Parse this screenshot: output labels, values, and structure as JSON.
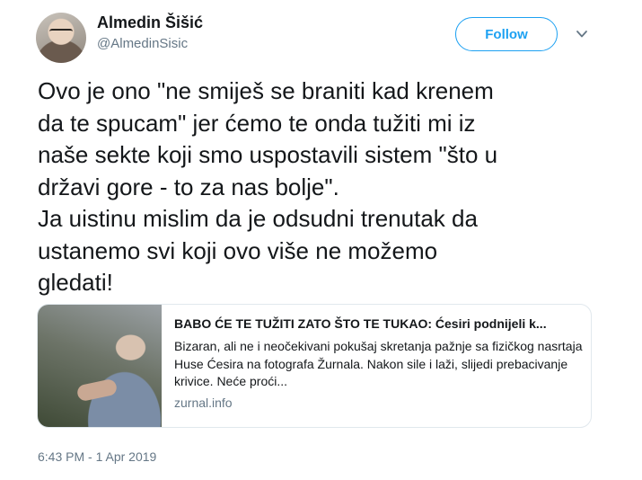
{
  "author": {
    "name": "Almedin Šišić",
    "handle": "@AlmedinSisic"
  },
  "follow_label": "Follow",
  "tweet": {
    "lines": [
      "Ovo je ono \"ne smiješ se braniti kad krenem",
      "da te spucam\" jer ćemo te onda tužiti mi iz",
      "naše sekte koji smo uspostavili sistem \"što u",
      "državi gore - to za nas bolje\".",
      "Ja uistinu mislim da je odsudni trenutak da",
      "ustanemo svi koji ovo više ne možemo",
      "gledati!"
    ]
  },
  "card": {
    "title": "BABO ĆE TE TUŽITI ZATO ŠTO TE TUKAO: Ćesiri podnijeli k...",
    "description": "Bizaran, ali ne i neočekivani pokušaj skretanja pažnje sa fizičkog nasrtaja Huse Ćesira na fotografa Žurnala. Nakon sile i laži, slijedi prebacivanje krivice. Neće proći...",
    "domain": "zurnal.info"
  },
  "timestamp": "6:43 PM - 1 Apr 2019",
  "colors": {
    "accent": "#1da1f2",
    "secondary_text": "#657786",
    "border": "#e1e8ed"
  },
  "icons": {
    "menu": "chevron-down-icon"
  }
}
